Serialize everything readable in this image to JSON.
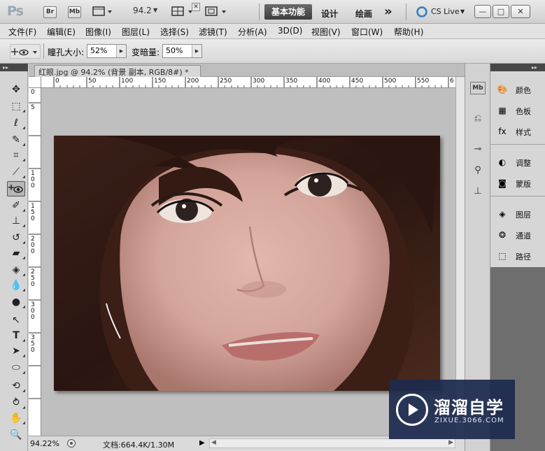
{
  "titlebar": {
    "logo": "Ps",
    "bridge_label": "Br",
    "minibridge_label": "Mb",
    "zoom_value": "94.2",
    "workspaces": [
      "基本功能",
      "设计",
      "绘画"
    ],
    "overflow": "»",
    "cslive": "CS Live",
    "controls": [
      "—",
      "□",
      "✕"
    ]
  },
  "menu": [
    "文件(F)",
    "编辑(E)",
    "图像(I)",
    "图层(L)",
    "选择(S)",
    "滤镜(T)",
    "分析(A)",
    "3D(D)",
    "视图(V)",
    "窗口(W)",
    "帮助(H)"
  ],
  "options": {
    "pupil_label": "瞳孔大小:",
    "pupil_value": "52%",
    "darken_label": "变暗量:",
    "darken_value": "50%"
  },
  "document": {
    "tab_title": "红眼.jpg @ 94.2% (背景 副本, RGB/8#) *",
    "close": "✕"
  },
  "ruler": {
    "h_labels": [
      "0",
      "50",
      "100",
      "150",
      "200",
      "250",
      "300",
      "350",
      "400",
      "450",
      "500",
      "550",
      "6"
    ],
    "v_labels": [
      "0",
      "5",
      "1 0 0",
      "1 5 0",
      "2 0 0",
      "2 5 0",
      "3 0 0",
      "3 5 0"
    ]
  },
  "status": {
    "zoom": "94.22%",
    "doc_info": "文档:664.4K/1.30M"
  },
  "panels": {
    "group1": [
      "颜色",
      "色板",
      "样式"
    ],
    "group2": [
      "调整",
      "蒙版"
    ],
    "group3": [
      "图层",
      "通道",
      "路径"
    ]
  },
  "watermark": {
    "title": "溜溜自学",
    "url": "ZIXUE.3066.COM"
  },
  "tools": [
    "move-tool-icon",
    "marquee-tool-icon",
    "lasso-tool-icon",
    "quick-selection-tool-icon",
    "crop-tool-icon",
    "eyedropper-tool-icon",
    "red-eye-tool-icon",
    "brush-tool-icon",
    "clone-stamp-tool-icon",
    "history-brush-tool-icon",
    "eraser-tool-icon",
    "paint-bucket-tool-icon",
    "blur-tool-icon",
    "dodge-tool-icon",
    "path-selection-tool-icon",
    "type-tool-icon",
    "direct-selection-tool-icon",
    "ellipse-tool-icon",
    "3d-rotate-tool-icon",
    "3d-orbit-tool-icon",
    "hand-tool-icon",
    "zoom-tool-icon"
  ]
}
